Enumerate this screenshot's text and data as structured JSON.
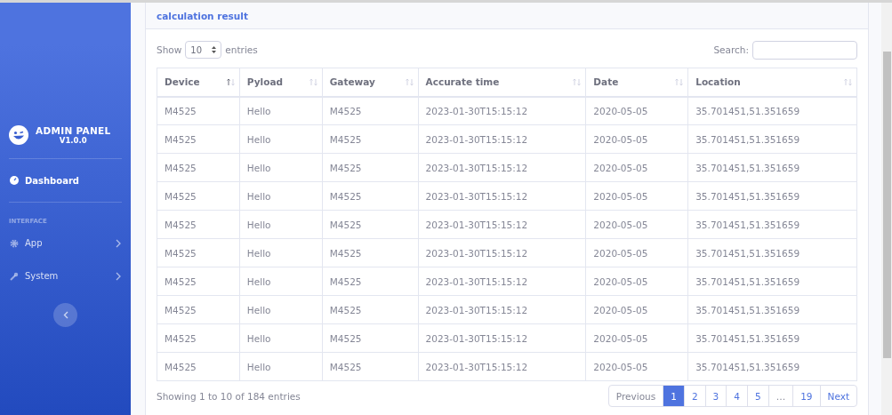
{
  "sidebar": {
    "brand": {
      "title": "ADMIN PANEL",
      "version": "V1.0.0"
    },
    "items": [
      {
        "kind": "link",
        "label": "Dashboard",
        "selected": true
      },
      {
        "kind": "heading",
        "label": "INTERFACE"
      },
      {
        "kind": "group",
        "label": "App",
        "selected": false
      },
      {
        "kind": "group",
        "label": "System",
        "selected": false
      }
    ]
  },
  "card": {
    "title": "calculation result",
    "length": {
      "before": "Show",
      "value": "10",
      "after": "entries"
    },
    "search": {
      "label": "Search:"
    },
    "table": {
      "columns": [
        {
          "label": "Device",
          "sorted": true
        },
        {
          "label": "Pyload",
          "sorted": false
        },
        {
          "label": "Gateway",
          "sorted": false
        },
        {
          "label": "Accurate time",
          "sorted": false
        },
        {
          "label": "Date",
          "sorted": false
        },
        {
          "label": "Location",
          "sorted": false
        }
      ],
      "rows": [
        [
          "M4525",
          "Hello",
          "M4525",
          "2023-01-30T15:15:12",
          "2020-05-05",
          "35.701451,51.351659"
        ],
        [
          "M4525",
          "Hello",
          "M4525",
          "2023-01-30T15:15:12",
          "2020-05-05",
          "35.701451,51.351659"
        ],
        [
          "M4525",
          "Hello",
          "M4525",
          "2023-01-30T15:15:12",
          "2020-05-05",
          "35.701451,51.351659"
        ],
        [
          "M4525",
          "Hello",
          "M4525",
          "2023-01-30T15:15:12",
          "2020-05-05",
          "35.701451,51.351659"
        ],
        [
          "M4525",
          "Hello",
          "M4525",
          "2023-01-30T15:15:12",
          "2020-05-05",
          "35.701451,51.351659"
        ],
        [
          "M4525",
          "Hello",
          "M4525",
          "2023-01-30T15:15:12",
          "2020-05-05",
          "35.701451,51.351659"
        ],
        [
          "M4525",
          "Hello",
          "M4525",
          "2023-01-30T15:15:12",
          "2020-05-05",
          "35.701451,51.351659"
        ],
        [
          "M4525",
          "Hello",
          "M4525",
          "2023-01-30T15:15:12",
          "2020-05-05",
          "35.701451,51.351659"
        ],
        [
          "M4525",
          "Hello",
          "M4525",
          "2023-01-30T15:15:12",
          "2020-05-05",
          "35.701451,51.351659"
        ],
        [
          "M4525",
          "Hello",
          "M4525",
          "2023-01-30T15:15:12",
          "2020-05-05",
          "35.701451,51.351659"
        ]
      ]
    },
    "info": "Showing 1 to 10 of 184 entries",
    "pagination": [
      {
        "kind": "nav",
        "label": "Previous",
        "disabled": true
      },
      {
        "kind": "page",
        "label": "1",
        "selected": true
      },
      {
        "kind": "page",
        "label": "2",
        "selected": false
      },
      {
        "kind": "page",
        "label": "3",
        "selected": false
      },
      {
        "kind": "page",
        "label": "4",
        "selected": false
      },
      {
        "kind": "page",
        "label": "5",
        "selected": false
      },
      {
        "kind": "ellipsis",
        "label": "…"
      },
      {
        "kind": "page",
        "label": "19",
        "selected": false
      },
      {
        "kind": "nav",
        "label": "Next",
        "disabled": false
      }
    ]
  }
}
